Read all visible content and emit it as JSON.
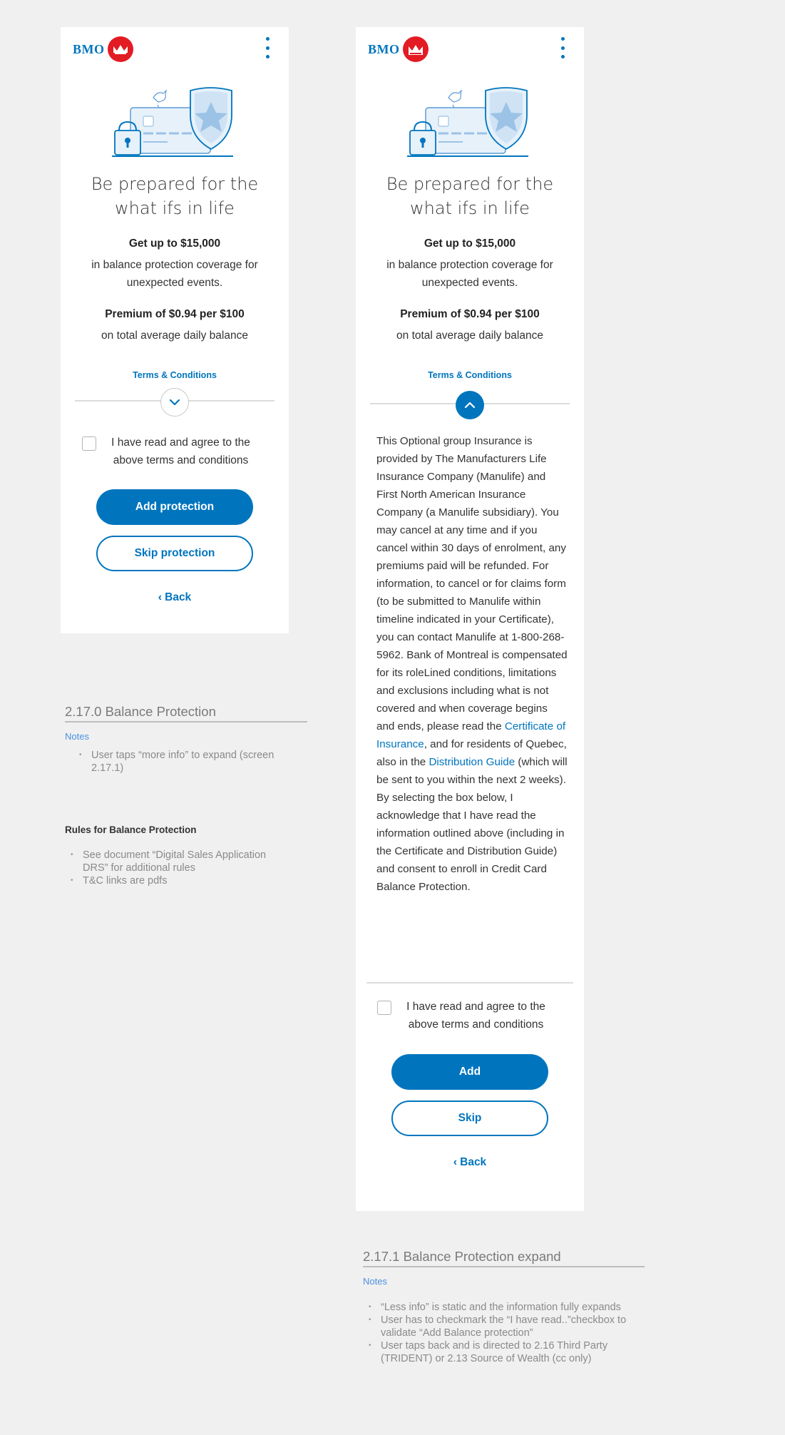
{
  "brand": {
    "name": "BMO",
    "accent": "#0075be",
    "roundel_color": "#e31b23"
  },
  "screens": [
    {
      "id": "2.17.0",
      "headline": "Be prepared for the what ifs in life",
      "coverage_bold": "Get up to $15,000",
      "coverage_sub": "in balance protection coverage for unexpected events.",
      "premium_bold": "Premium of $0.94 per $100",
      "premium_sub": "on total average daily balance",
      "terms_link": "Terms & Conditions",
      "toggle_icon": "chevron-down-icon",
      "agree_label": "I have read and agree to the above terms and conditions",
      "checkbox_checked": false,
      "primary_button": "Add protection",
      "secondary_button": "Skip protection",
      "back_label": "Back"
    },
    {
      "id": "2.17.1",
      "headline": "Be prepared for the what ifs in life",
      "coverage_bold": "Get up to $15,000",
      "coverage_sub": "in balance protection coverage for unexpected events.",
      "premium_bold": "Premium of $0.94 per $100",
      "premium_sub": "on total average daily balance",
      "terms_link": "Terms & Conditions",
      "toggle_icon": "chevron-up-icon",
      "legal": {
        "part1": "This Optional group Insurance is provided by The Manufacturers Life Insurance Company (Manulife) and First North American Insurance Company (a Manulife subsidiary). You may cancel at any time and if you cancel within 30 days of enrolment, any premiums paid will be refunded. For information, to cancel or for claims form (to be submitted to Manulife within timeline indicated in your Certificate), you can contact Manulife at 1-800-268-5962. Bank of Montreal is compensated for its roleLined conditions, limitations and exclusions including what is not covered and when coverage begins and ends, please read the ",
        "link1": "Certificate of Insurance",
        "part2": ", and for residents of Quebec, also in the ",
        "link2": "Distribution Guide",
        "part3": " (which will be sent to you within the next 2 weeks).",
        "part4": "By selecting the box below, I acknowledge that I have read the information outlined above (including in the Certificate and Distribution Guide) and consent to enroll in Credit Card Balance Protection."
      },
      "agree_label": "I have read and agree to the above terms and conditions",
      "checkbox_checked": false,
      "primary_button": "Add",
      "secondary_button": "Skip",
      "back_label": "Back"
    }
  ],
  "annotations": {
    "screen_a": {
      "title": "2.17.0 Balance Protection",
      "notes_label": "Notes",
      "notes": [
        "User taps “more info” to expand (screen 2.17.1)"
      ],
      "rules_title": "Rules for Balance Protection",
      "rules": [
        "See document “Digital Sales Application DRS” for additional rules",
        "T&C links are pdfs"
      ]
    },
    "screen_b": {
      "title": "2.17.1 Balance Protection expand",
      "notes_label": "Notes",
      "notes": [
        "“Less info” is static and the information fully expands",
        "User has to checkmark the “I have read..”checkbox to validate “Add Balance protection”",
        "User taps back and is directed to 2.16 Third Party (TRIDENT) or 2.13 Source of Wealth (cc only)"
      ]
    }
  }
}
